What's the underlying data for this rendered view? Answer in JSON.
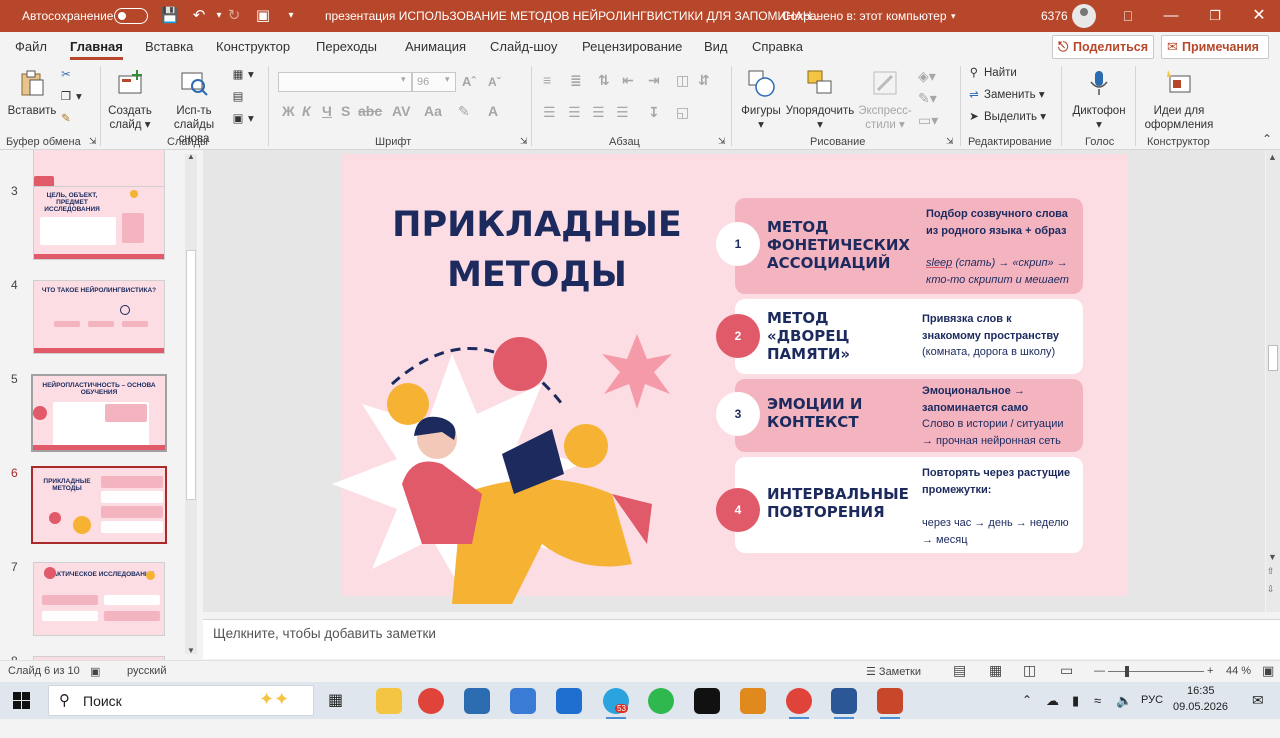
{
  "titlebar": {
    "autosave_label": "Автосохранение",
    "document_title": "презентация ИСПОЛЬЗОВАНИЕ МЕТОДОВ НЕЙРОЛИНГВИСТИКИ ДЛЯ ЗАПОМИНАН...",
    "save_status": "Сохранено в: этот компьютер",
    "user_code": "6376"
  },
  "menu": {
    "tabs": [
      "Файл",
      "Главная",
      "Вставка",
      "Конструктор",
      "Переходы",
      "Анимация",
      "Слайд-шоу",
      "Рецензирование",
      "Вид",
      "Справка"
    ],
    "share_label": "Поделиться",
    "comments_label": "Примечания"
  },
  "ribbon": {
    "paste_label": "Вставить",
    "clipboard_group": "Буфер обмена",
    "new_slide_label": "Создать слайд",
    "reuse_slides_label": "Исп-ть слайды снова",
    "slides_group": "Слайды",
    "font_size": "96",
    "font_group": "Шрифт",
    "paragraph_group": "Абзац",
    "shapes_label": "Фигуры",
    "arrange_label": "Упорядочить",
    "quick_styles_label": "Экспресс-стили",
    "drawing_group": "Рисование",
    "find_label": "Найти",
    "replace_label": "Заменить",
    "select_label": "Выделить",
    "editing_group": "Редактирование",
    "dictate_label": "Диктофон",
    "voice_group": "Голос",
    "designer_label": "Идеи для оформления",
    "designer_group": "Конструктор"
  },
  "thumbnails": {
    "numbers": [
      "3",
      "4",
      "5",
      "6",
      "7",
      "8"
    ],
    "t3_title": "ЦЕЛЬ, ОБЪЕКТ, ПРЕДМЕТ ИССЛЕДОВАНИЯ",
    "t4_title": "ЧТО ТАКОЕ НЕЙРОЛИНГВИСТИКА?",
    "t5_title": "НЕЙРОПЛАСТИЧНОСТЬ – ОСНОВА ОБУЧЕНИЯ",
    "t6_title": "ПРИКЛАДНЫЕ МЕТОДЫ",
    "t7_title": "ПРАКТИЧЕСКОЕ ИССЛЕДОВАНИЕ"
  },
  "slide": {
    "title": "ПРИКЛАДНЫЕ МЕТОДЫ",
    "methods": [
      {
        "num": "1",
        "name": "МЕТОД\nФОНЕТИЧЕСКИХ\nАССОЦИАЦИЙ",
        "desc1": "Подбор созвучного слова\nиз родного языка + образ",
        "desc2_underlined": "sleep",
        "desc2_rest": " (спать) → «скрип» →\nкто-то скрипит и мешает"
      },
      {
        "num": "2",
        "name": "МЕТОД\n«ДВОРЕЦ\nПАМЯТИ»",
        "desc1": "Привязка слов к\nзнакомому пространству",
        "desc2": "(комната, дорога в школу)"
      },
      {
        "num": "3",
        "name": "ЭМОЦИИ И\nКОНТЕКСТ",
        "desc1": "Эмоциональное →\nзапоминается само",
        "desc2": "Слово в истории / ситуации\n→ прочная нейронная сеть"
      },
      {
        "num": "4",
        "name": "ИНТЕРВАЛЬНЫЕ\nПОВТОРЕНИЯ",
        "desc1": "Повторять через растущие\nпромежутки:",
        "desc2": "через час → день → неделю\n→ месяц"
      }
    ]
  },
  "notes": {
    "placeholder": "Щелкните, чтобы добавить заметки"
  },
  "status": {
    "slide_counter": "Слайд 6 из 10",
    "language": "русский",
    "notes_button": "Заметки",
    "zoom": "44 %"
  },
  "taskbar": {
    "search_label": "Поиск",
    "badge_count": "53",
    "language": "РУС",
    "time": "16:35",
    "date": "09.05.2026"
  },
  "colors": {
    "accent": "#b7472a",
    "navy": "#1c2a5e",
    "coral": "#e05a6a",
    "slide_bg": "#fbdde3",
    "card_pink": "#f3b4c0"
  }
}
